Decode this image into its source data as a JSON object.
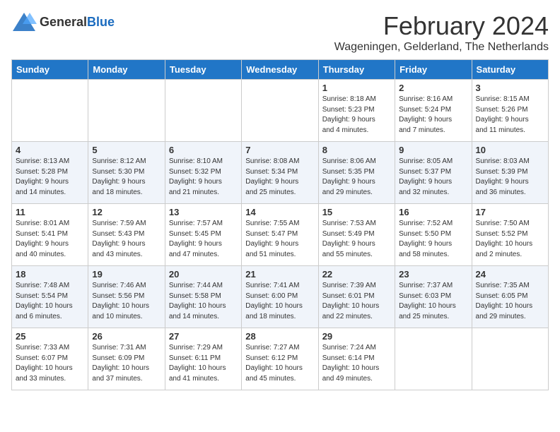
{
  "logo": {
    "general": "General",
    "blue": "Blue"
  },
  "title": "February 2024",
  "location": "Wageningen, Gelderland, The Netherlands",
  "days_of_week": [
    "Sunday",
    "Monday",
    "Tuesday",
    "Wednesday",
    "Thursday",
    "Friday",
    "Saturday"
  ],
  "weeks": [
    [
      {
        "day": "",
        "info": ""
      },
      {
        "day": "",
        "info": ""
      },
      {
        "day": "",
        "info": ""
      },
      {
        "day": "",
        "info": ""
      },
      {
        "day": "1",
        "info": "Sunrise: 8:18 AM\nSunset: 5:23 PM\nDaylight: 9 hours\nand 4 minutes."
      },
      {
        "day": "2",
        "info": "Sunrise: 8:16 AM\nSunset: 5:24 PM\nDaylight: 9 hours\nand 7 minutes."
      },
      {
        "day": "3",
        "info": "Sunrise: 8:15 AM\nSunset: 5:26 PM\nDaylight: 9 hours\nand 11 minutes."
      }
    ],
    [
      {
        "day": "4",
        "info": "Sunrise: 8:13 AM\nSunset: 5:28 PM\nDaylight: 9 hours\nand 14 minutes."
      },
      {
        "day": "5",
        "info": "Sunrise: 8:12 AM\nSunset: 5:30 PM\nDaylight: 9 hours\nand 18 minutes."
      },
      {
        "day": "6",
        "info": "Sunrise: 8:10 AM\nSunset: 5:32 PM\nDaylight: 9 hours\nand 21 minutes."
      },
      {
        "day": "7",
        "info": "Sunrise: 8:08 AM\nSunset: 5:34 PM\nDaylight: 9 hours\nand 25 minutes."
      },
      {
        "day": "8",
        "info": "Sunrise: 8:06 AM\nSunset: 5:35 PM\nDaylight: 9 hours\nand 29 minutes."
      },
      {
        "day": "9",
        "info": "Sunrise: 8:05 AM\nSunset: 5:37 PM\nDaylight: 9 hours\nand 32 minutes."
      },
      {
        "day": "10",
        "info": "Sunrise: 8:03 AM\nSunset: 5:39 PM\nDaylight: 9 hours\nand 36 minutes."
      }
    ],
    [
      {
        "day": "11",
        "info": "Sunrise: 8:01 AM\nSunset: 5:41 PM\nDaylight: 9 hours\nand 40 minutes."
      },
      {
        "day": "12",
        "info": "Sunrise: 7:59 AM\nSunset: 5:43 PM\nDaylight: 9 hours\nand 43 minutes."
      },
      {
        "day": "13",
        "info": "Sunrise: 7:57 AM\nSunset: 5:45 PM\nDaylight: 9 hours\nand 47 minutes."
      },
      {
        "day": "14",
        "info": "Sunrise: 7:55 AM\nSunset: 5:47 PM\nDaylight: 9 hours\nand 51 minutes."
      },
      {
        "day": "15",
        "info": "Sunrise: 7:53 AM\nSunset: 5:49 PM\nDaylight: 9 hours\nand 55 minutes."
      },
      {
        "day": "16",
        "info": "Sunrise: 7:52 AM\nSunset: 5:50 PM\nDaylight: 9 hours\nand 58 minutes."
      },
      {
        "day": "17",
        "info": "Sunrise: 7:50 AM\nSunset: 5:52 PM\nDaylight: 10 hours\nand 2 minutes."
      }
    ],
    [
      {
        "day": "18",
        "info": "Sunrise: 7:48 AM\nSunset: 5:54 PM\nDaylight: 10 hours\nand 6 minutes."
      },
      {
        "day": "19",
        "info": "Sunrise: 7:46 AM\nSunset: 5:56 PM\nDaylight: 10 hours\nand 10 minutes."
      },
      {
        "day": "20",
        "info": "Sunrise: 7:44 AM\nSunset: 5:58 PM\nDaylight: 10 hours\nand 14 minutes."
      },
      {
        "day": "21",
        "info": "Sunrise: 7:41 AM\nSunset: 6:00 PM\nDaylight: 10 hours\nand 18 minutes."
      },
      {
        "day": "22",
        "info": "Sunrise: 7:39 AM\nSunset: 6:01 PM\nDaylight: 10 hours\nand 22 minutes."
      },
      {
        "day": "23",
        "info": "Sunrise: 7:37 AM\nSunset: 6:03 PM\nDaylight: 10 hours\nand 25 minutes."
      },
      {
        "day": "24",
        "info": "Sunrise: 7:35 AM\nSunset: 6:05 PM\nDaylight: 10 hours\nand 29 minutes."
      }
    ],
    [
      {
        "day": "25",
        "info": "Sunrise: 7:33 AM\nSunset: 6:07 PM\nDaylight: 10 hours\nand 33 minutes."
      },
      {
        "day": "26",
        "info": "Sunrise: 7:31 AM\nSunset: 6:09 PM\nDaylight: 10 hours\nand 37 minutes."
      },
      {
        "day": "27",
        "info": "Sunrise: 7:29 AM\nSunset: 6:11 PM\nDaylight: 10 hours\nand 41 minutes."
      },
      {
        "day": "28",
        "info": "Sunrise: 7:27 AM\nSunset: 6:12 PM\nDaylight: 10 hours\nand 45 minutes."
      },
      {
        "day": "29",
        "info": "Sunrise: 7:24 AM\nSunset: 6:14 PM\nDaylight: 10 hours\nand 49 minutes."
      },
      {
        "day": "",
        "info": ""
      },
      {
        "day": "",
        "info": ""
      }
    ]
  ]
}
